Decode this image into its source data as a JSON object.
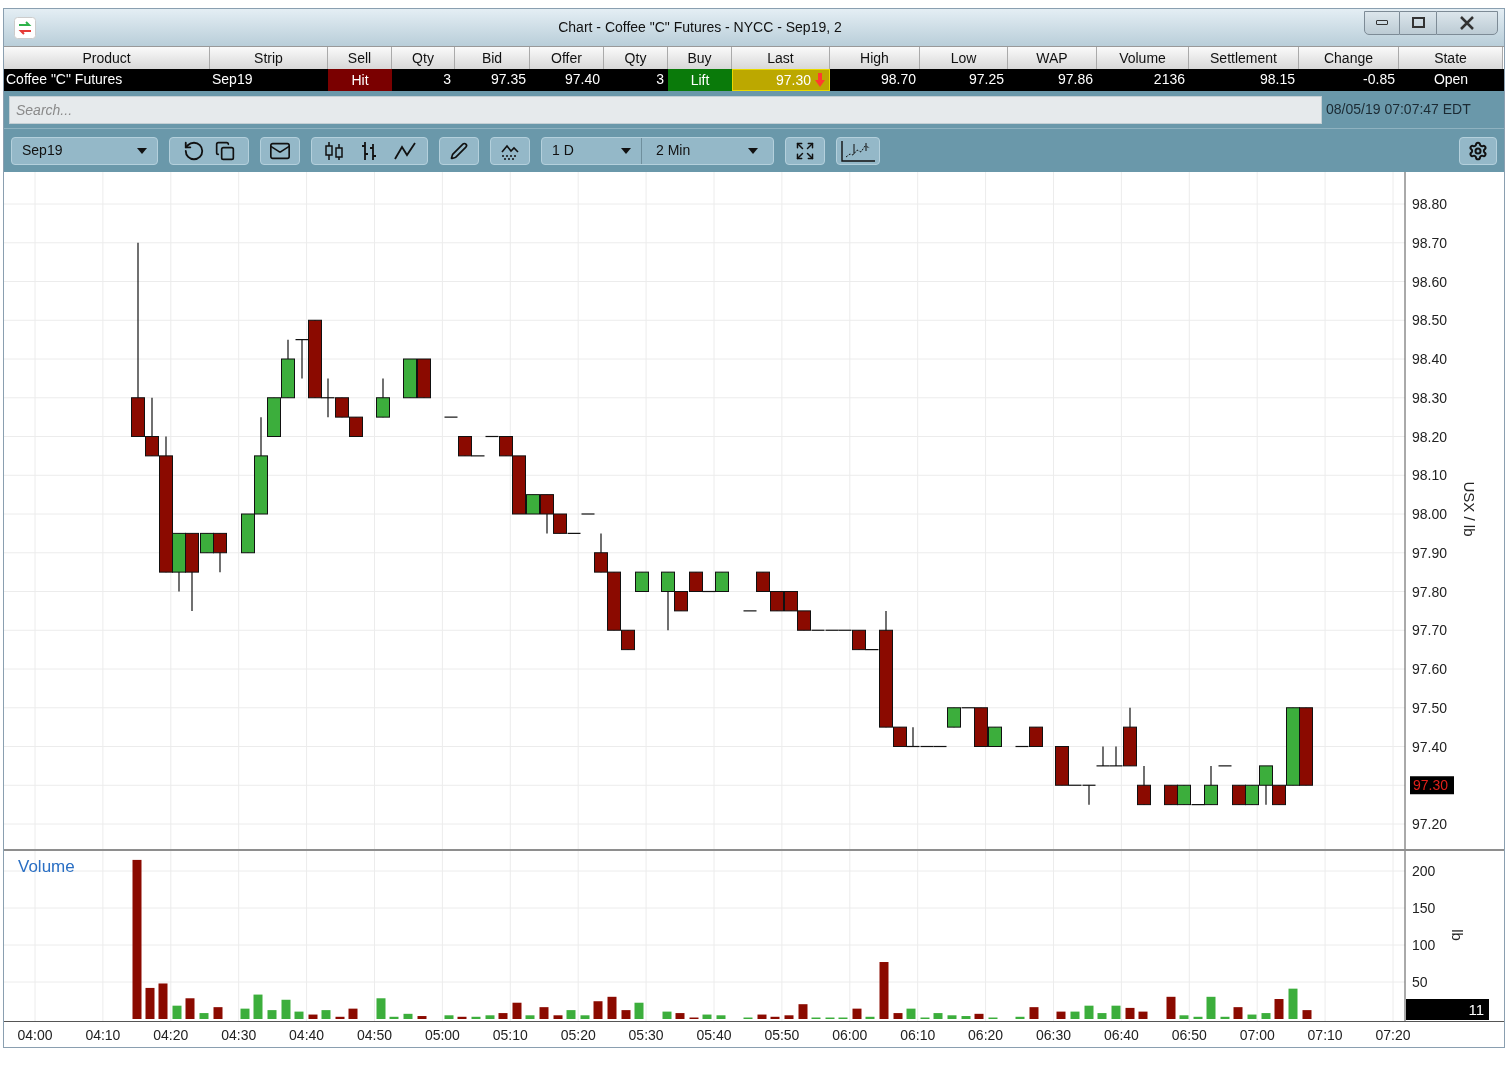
{
  "window": {
    "title": "Chart - Coffee \"C\" Futures - NYCC - Sep19, 2"
  },
  "quote_table": {
    "columns": [
      "Product",
      "Strip",
      "Sell",
      "Qty",
      "Bid",
      "Offer",
      "Qty",
      "Buy",
      "Last",
      "High",
      "Low",
      "WAP",
      "Volume",
      "Settlement",
      "Change",
      "State"
    ],
    "cells": [
      {
        "text": "Coffee \"C\" Futures",
        "kind": "left"
      },
      {
        "text": "Sep19",
        "kind": "left"
      },
      {
        "text": "Hit",
        "kind": "sell"
      },
      {
        "text": "3",
        "kind": "num"
      },
      {
        "text": "97.35",
        "kind": "num"
      },
      {
        "text": "97.40",
        "kind": "num"
      },
      {
        "text": "3",
        "kind": "num"
      },
      {
        "text": "Lift",
        "kind": "buy"
      },
      {
        "text": "97.30",
        "kind": "last"
      },
      {
        "text": "98.70",
        "kind": "num"
      },
      {
        "text": "97.25",
        "kind": "num"
      },
      {
        "text": "97.86",
        "kind": "num"
      },
      {
        "text": "2136",
        "kind": "num"
      },
      {
        "text": "98.15",
        "kind": "num"
      },
      {
        "text": "-0.85",
        "kind": "num"
      },
      {
        "text": "Open",
        "kind": "center"
      }
    ]
  },
  "search": {
    "placeholder": "Search..."
  },
  "timestamp": "08/05/19 07:07:47 EDT",
  "toolbar": {
    "contract": "Sep19",
    "range": "1 D",
    "interval": "2 Min"
  },
  "price_chart": {
    "axis_label": "USX / lb",
    "y_ticks": [
      {
        "label": "98.80",
        "kind": "tick"
      },
      {
        "label": "98.70",
        "kind": "tick"
      },
      {
        "label": "98.60",
        "kind": "tick"
      },
      {
        "label": "98.50",
        "kind": "tick"
      },
      {
        "label": "98.40",
        "kind": "tick"
      },
      {
        "label": "98.30",
        "kind": "tick"
      },
      {
        "label": "98.20",
        "kind": "tick"
      },
      {
        "label": "98.10",
        "kind": "tick"
      },
      {
        "label": "98.00",
        "kind": "tick"
      },
      {
        "label": "97.90",
        "kind": "tick"
      },
      {
        "label": "97.80",
        "kind": "tick"
      },
      {
        "label": "97.70",
        "kind": "tick"
      },
      {
        "label": "97.60",
        "kind": "tick"
      },
      {
        "label": "97.50",
        "kind": "tick"
      },
      {
        "label": "97.40",
        "kind": "tick"
      },
      {
        "label": "97.30",
        "kind": "last"
      },
      {
        "label": "97.20",
        "kind": "tick"
      }
    ]
  },
  "volume_chart": {
    "title": "Volume",
    "axis_label": "lb",
    "y_ticks": [
      "200",
      "150",
      "100",
      "50"
    ],
    "last_volume": "11"
  },
  "time_axis": [
    "04:00",
    "04:10",
    "04:20",
    "04:30",
    "04:40",
    "04:50",
    "05:00",
    "05:10",
    "05:20",
    "05:30",
    "05:40",
    "05:50",
    "06:00",
    "06:10",
    "06:20",
    "06:30",
    "06:40",
    "06:50",
    "07:00",
    "07:10",
    "07:20"
  ]
}
